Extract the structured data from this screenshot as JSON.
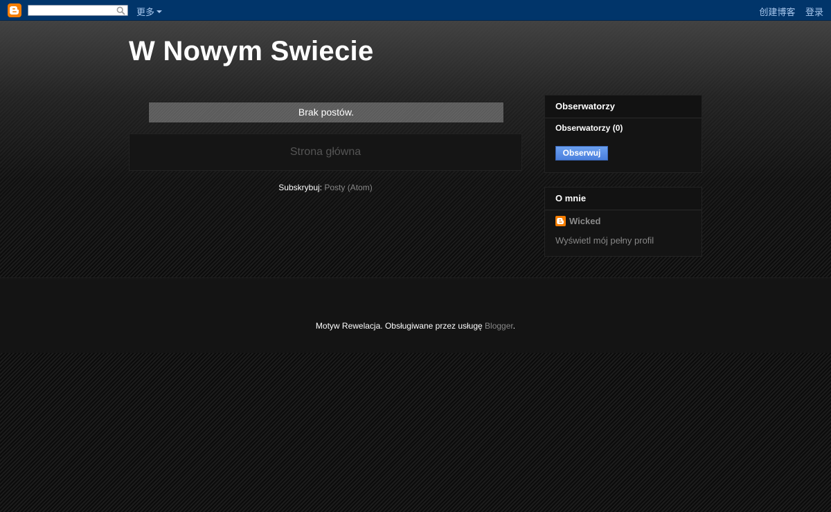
{
  "navbar": {
    "logo_icon": "blogger-logo-icon",
    "search_value": "",
    "search_icon": "search-icon",
    "more_label": "更多",
    "create_blog_label": "创建博客",
    "login_label": "登录",
    "background_color": "#01356a"
  },
  "header": {
    "title": "W Nowym Swiecie"
  },
  "main": {
    "no_posts_text": "Brak postów.",
    "home_link_label": "Strona główna",
    "subscribe": {
      "label": "Subskrybuj:",
      "link_label": "Posty (Atom)"
    }
  },
  "sidebar": {
    "followers": {
      "title": "Obserwatorzy",
      "count_label": "Obserwatorzy (0)",
      "follow_button_label": "Obserwuj",
      "button_color": "#5b8ee6"
    },
    "about": {
      "title": "O mnie",
      "profile_name": "Wicked",
      "profile_icon": "blogger-profile-icon",
      "profile_link_label": "Wyświetl mój pełny profil"
    }
  },
  "footer": {
    "theme_text": "Motyw Rewelacja. Obsługiwane przez usługę",
    "blogger_link_label": "Blogger",
    "trailing_text": "."
  }
}
